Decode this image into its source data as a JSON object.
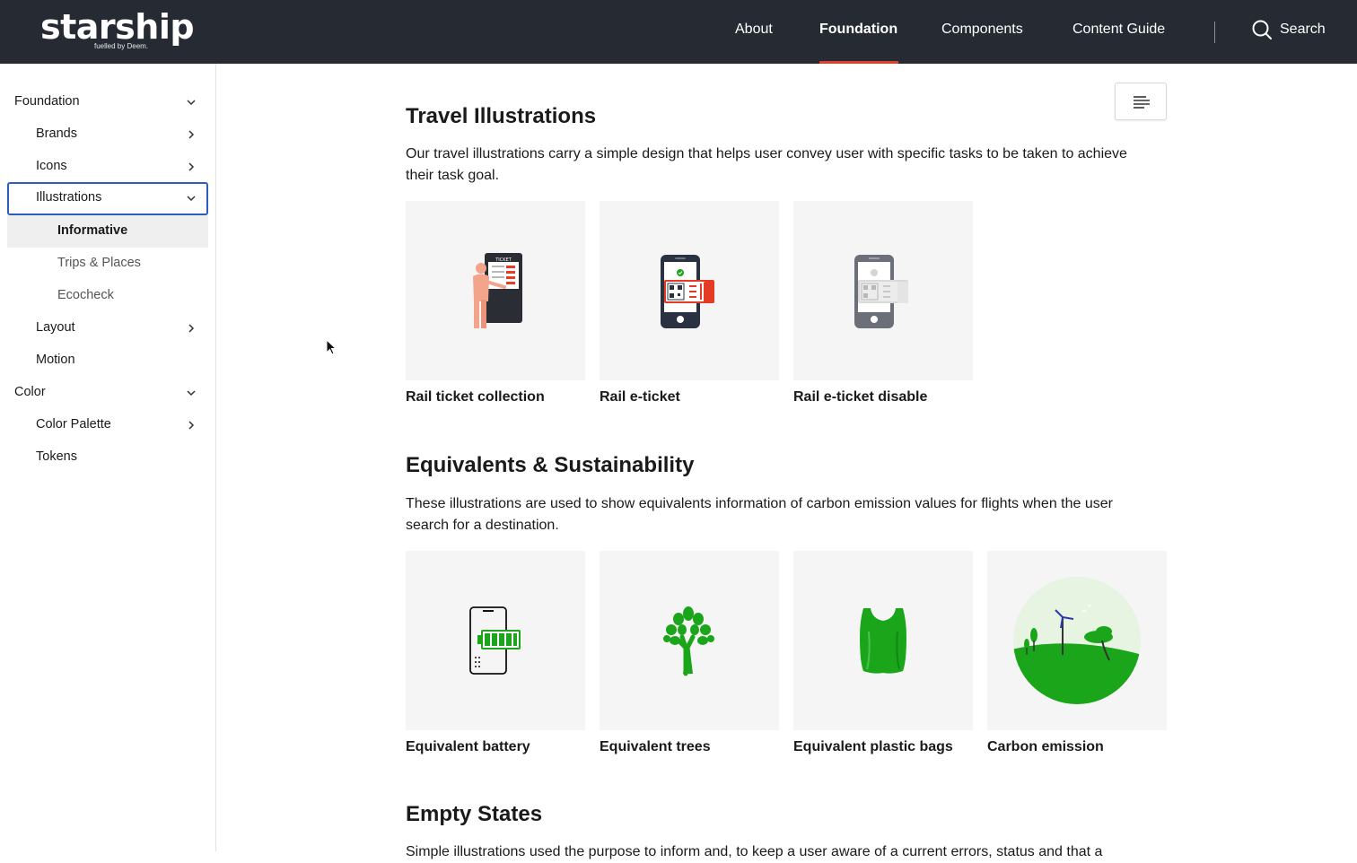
{
  "header": {
    "logo_text": "starship",
    "logo_tagline": "fuelled by Deem.",
    "nav": [
      {
        "label": "About"
      },
      {
        "label": "Foundation"
      },
      {
        "label": "Components"
      },
      {
        "label": "Content Guide"
      }
    ],
    "active_nav": "Foundation",
    "search_label": "Search",
    "accent_color": "#e0402a"
  },
  "sidebar": {
    "items": [
      {
        "label": "Foundation",
        "expanded": true
      },
      {
        "label": "Brands",
        "expanded": false
      },
      {
        "label": "Icons",
        "expanded": false
      },
      {
        "label": "Illustrations",
        "expanded": true,
        "focused": true
      },
      {
        "label": "Informative",
        "selected": true
      },
      {
        "label": "Trips & Places"
      },
      {
        "label": "Ecocheck"
      },
      {
        "label": "Layout",
        "expanded": false
      },
      {
        "label": "Motion"
      },
      {
        "label": "Color",
        "expanded": true
      },
      {
        "label": "Color Palette",
        "expanded": false
      },
      {
        "label": "Tokens"
      }
    ]
  },
  "main": {
    "sections": [
      {
        "title": "Travel Illustrations",
        "description": "Our travel illustrations carry a simple design that helps user convey user with specific tasks to be taken to achieve their task goal.",
        "cards": [
          {
            "caption": "Rail ticket collection",
            "icon": "rail-ticket-collection-illustration"
          },
          {
            "caption": "Rail e-ticket",
            "icon": "rail-e-ticket-illustration"
          },
          {
            "caption": "Rail e-ticket disable",
            "icon": "rail-e-ticket-disabled-illustration"
          }
        ]
      },
      {
        "title": "Equivalents & Sustainability",
        "description": "These illustrations are used to show equivalents information of carbon emission values for flights when the user search for a destination.",
        "cards": [
          {
            "caption": "Equivalent battery",
            "icon": "battery-illustration"
          },
          {
            "caption": "Equivalent trees",
            "icon": "tree-illustration"
          },
          {
            "caption": "Equivalent plastic bags",
            "icon": "plastic-bag-illustration"
          },
          {
            "caption": "Carbon emission",
            "icon": "carbon-emission-illustration"
          }
        ]
      },
      {
        "title": "Empty States",
        "description": "Simple illustrations used the purpose to inform and, to keep a user aware of a current errors, status and that a"
      }
    ]
  },
  "colors": {
    "header_bg": "#262b33",
    "illustration_green": "#1aa51a",
    "rail_red": "#e53b25",
    "focus_blue": "#2d5dbf"
  }
}
